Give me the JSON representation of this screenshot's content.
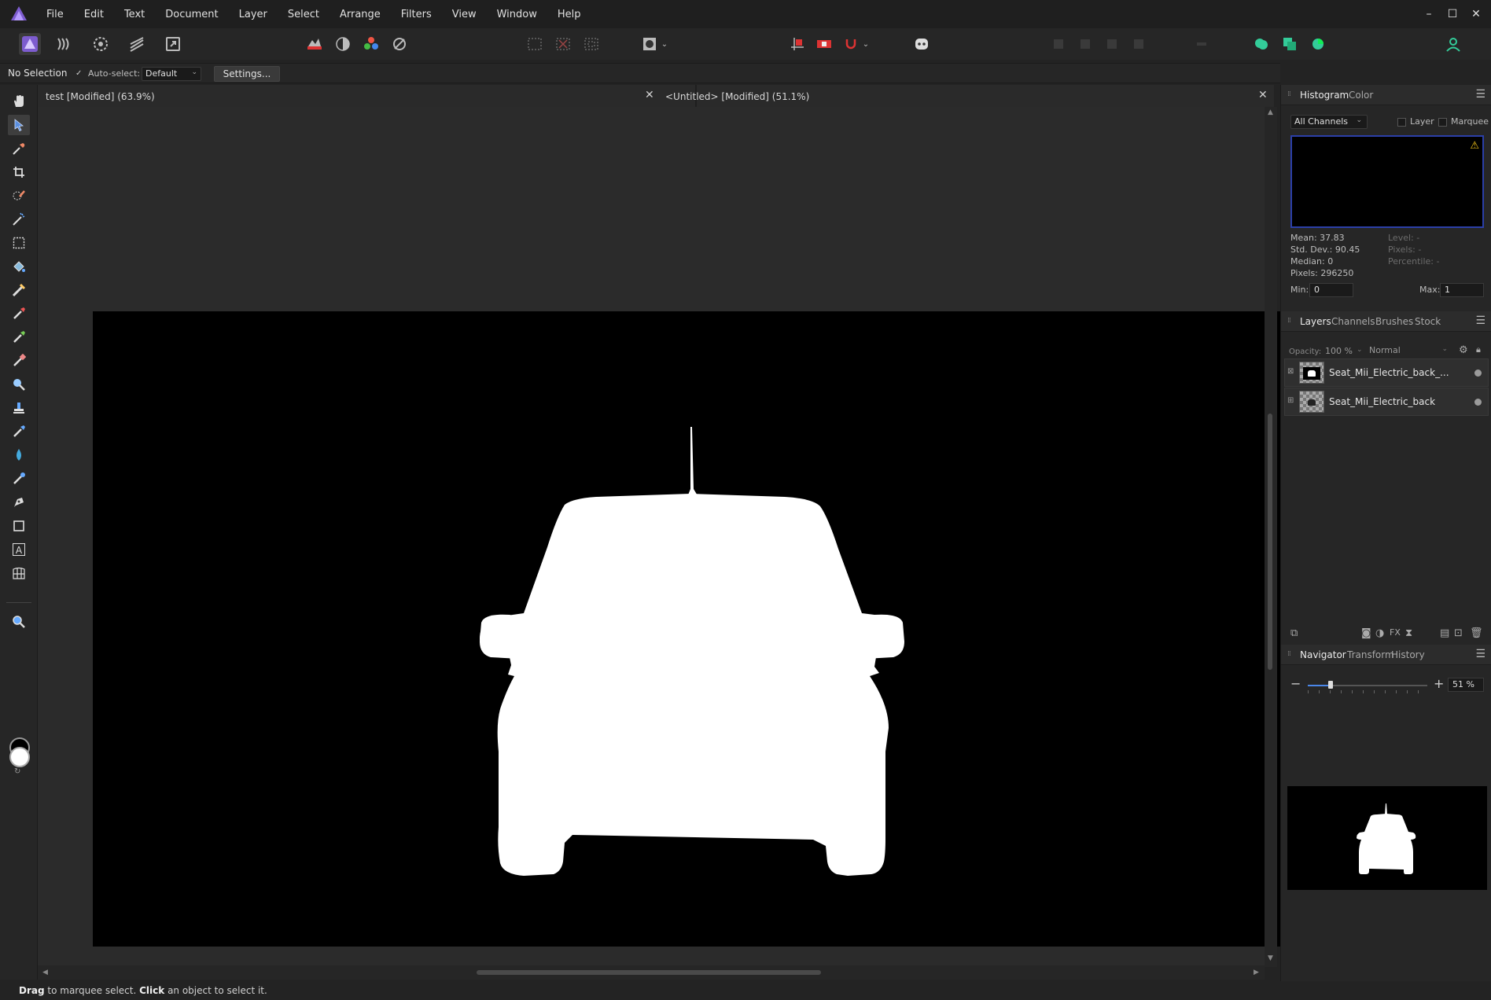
{
  "menu": {
    "items": [
      "File",
      "Edit",
      "Text",
      "Document",
      "Layer",
      "Select",
      "Arrange",
      "Filters",
      "View",
      "Window",
      "Help"
    ],
    "window_controls": [
      "–",
      "☐",
      "✕"
    ]
  },
  "context": {
    "selection_label": "No Selection",
    "auto_select_label": "Auto-select:",
    "auto_select_value": "Default",
    "settings_label": "Settings..."
  },
  "tabs": {
    "doc1": "test [Modified] (63.9%)",
    "doc2": "<Untitled> [Modified] (51.1%)",
    "close": "✕"
  },
  "status": {
    "drag": "Drag",
    "drag_rest": " to marquee select. ",
    "click": "Click",
    "click_rest": " an object to select it."
  },
  "histogram": {
    "tab_histogram": "Histogram",
    "tab_color": "Color",
    "channel": "All Channels",
    "layer_label": "Layer",
    "marquee_label": "Marquee",
    "mean": "Mean: 37.83",
    "std_dev": "Std. Dev.: 90.45",
    "median": "Median: 0",
    "pixels": "Pixels: 296250",
    "level": "Level: -",
    "pixels_sel": "Pixels: -",
    "percentile": "Percentile: -",
    "min_label": "Min:",
    "min_value": "0",
    "max_label": "Max:",
    "max_value": "1"
  },
  "layers": {
    "tabs": [
      "Layers",
      "Channels",
      "Brushes",
      "Stock"
    ],
    "opacity_label": "Opacity:",
    "opacity_value": "100 %",
    "blend_mode": "Normal",
    "items": [
      {
        "name": "Seat_Mii_Electric_back_..."
      },
      {
        "name": "Seat_Mii_Electric_back"
      }
    ]
  },
  "navigator": {
    "tabs": [
      "Navigator",
      "Transform",
      "History"
    ],
    "zoom_value": "51 %",
    "zoom_minus": "−",
    "zoom_plus": "+"
  },
  "colors": {
    "accent": "#4a86e8",
    "histogram_border": "#2b3fa8",
    "warning": "#f2c318",
    "canvas": "#000000",
    "car": "#ffffff"
  }
}
